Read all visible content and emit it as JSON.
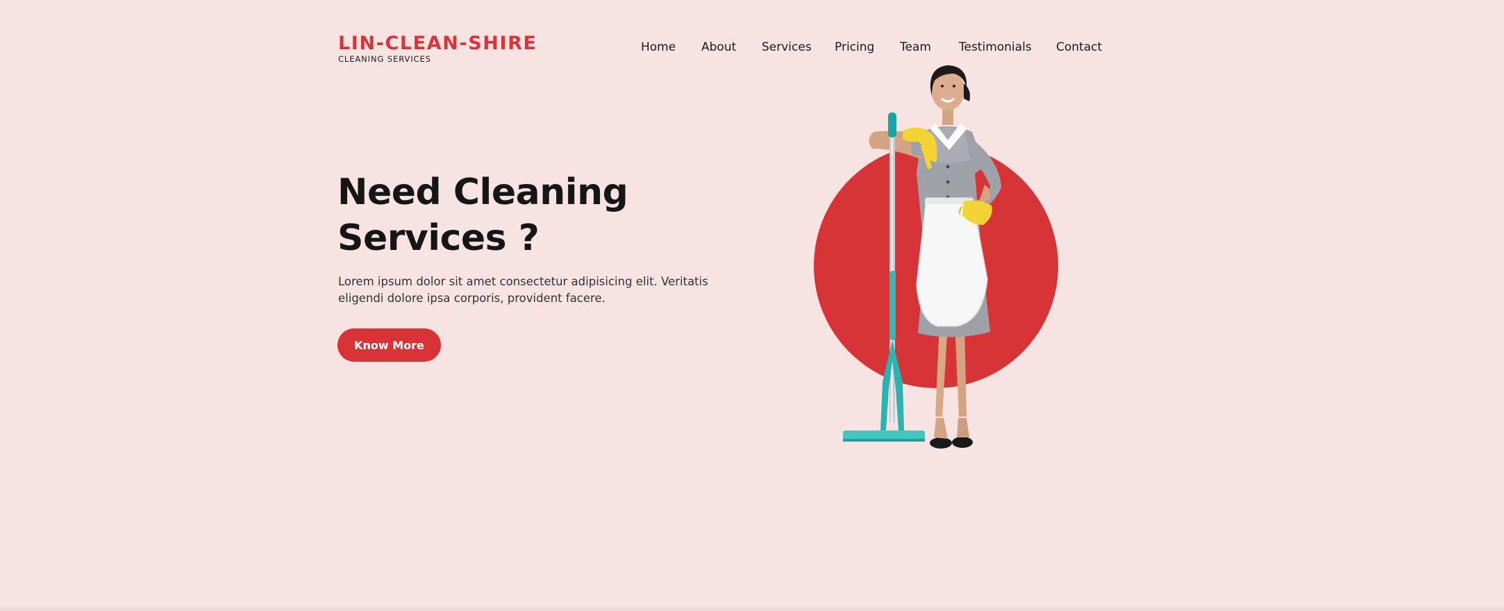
{
  "brand": {
    "name": "LIN-CLEAN-SHIRE",
    "tagline": "CLEANING SERVICES"
  },
  "nav": {
    "items": [
      {
        "label": "Home"
      },
      {
        "label": "About"
      },
      {
        "label": "Services"
      },
      {
        "label": "Pricing"
      },
      {
        "label": "Team"
      },
      {
        "label": "Testimonials"
      },
      {
        "label": "Contact"
      }
    ]
  },
  "hero": {
    "title_line1": "Need Cleaning",
    "title_line2": "Services ?",
    "text_line1": "Lorem ipsum dolor sit amet consectetur adipisicing elit. Veritatis",
    "text_line2": "eligendi dolore ipsa corporis, provident facere.",
    "cta_label": "Know More",
    "image": "cleaning-lady-with-mop-illustration"
  },
  "colors": {
    "background": "#f8e3e3",
    "accent": "#d83437",
    "text": "#171717"
  }
}
